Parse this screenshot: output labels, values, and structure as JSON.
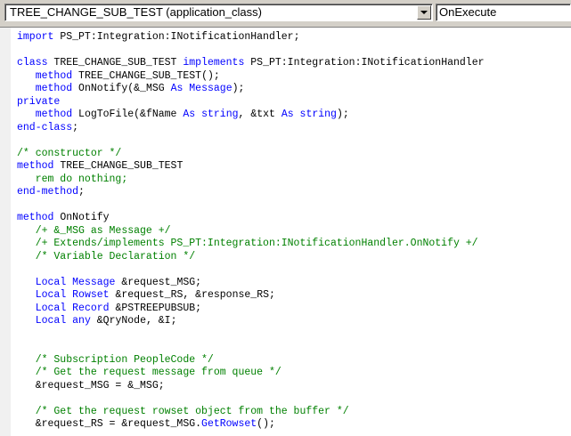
{
  "toolbar": {
    "object_name": "TREE_CHANGE_SUB_TEST  (application_class)",
    "event_name": "OnExecute"
  },
  "colors": {
    "keyword": "#0000ff",
    "comment": "#008000",
    "text": "#000000"
  },
  "code_lines": [
    [
      {
        "t": "import",
        "s": "kw"
      },
      {
        "t": " PS_PT:Integration:INotificationHandler;",
        "s": ""
      }
    ],
    [],
    [
      {
        "t": "class",
        "s": "kw"
      },
      {
        "t": " TREE_CHANGE_SUB_TEST ",
        "s": ""
      },
      {
        "t": "implements",
        "s": "kw"
      },
      {
        "t": " PS_PT:Integration:INotificationHandler",
        "s": ""
      }
    ],
    [
      {
        "t": "   ",
        "s": ""
      },
      {
        "t": "method",
        "s": "kw"
      },
      {
        "t": " TREE_CHANGE_SUB_TEST();",
        "s": ""
      }
    ],
    [
      {
        "t": "   ",
        "s": ""
      },
      {
        "t": "method",
        "s": "kw"
      },
      {
        "t": " OnNotify(&_MSG ",
        "s": ""
      },
      {
        "t": "As",
        "s": "kw"
      },
      {
        "t": " ",
        "s": ""
      },
      {
        "t": "Message",
        "s": "kw"
      },
      {
        "t": ");",
        "s": ""
      }
    ],
    [
      {
        "t": "private",
        "s": "kw"
      }
    ],
    [
      {
        "t": "   ",
        "s": ""
      },
      {
        "t": "method",
        "s": "kw"
      },
      {
        "t": " LogToFile(&fName ",
        "s": ""
      },
      {
        "t": "As",
        "s": "kw"
      },
      {
        "t": " ",
        "s": ""
      },
      {
        "t": "string",
        "s": "kw"
      },
      {
        "t": ", &txt ",
        "s": ""
      },
      {
        "t": "As",
        "s": "kw"
      },
      {
        "t": " ",
        "s": ""
      },
      {
        "t": "string",
        "s": "kw"
      },
      {
        "t": ");",
        "s": ""
      }
    ],
    [
      {
        "t": "end-class",
        "s": "kw"
      },
      {
        "t": ";",
        "s": ""
      }
    ],
    [],
    [
      {
        "t": "/* constructor */",
        "s": "cm"
      }
    ],
    [
      {
        "t": "method",
        "s": "kw"
      },
      {
        "t": " TREE_CHANGE_SUB_TEST",
        "s": ""
      }
    ],
    [
      {
        "t": "   rem do nothing;",
        "s": "cm"
      }
    ],
    [
      {
        "t": "end-method",
        "s": "kw"
      },
      {
        "t": ";",
        "s": ""
      }
    ],
    [],
    [
      {
        "t": "method",
        "s": "kw"
      },
      {
        "t": " OnNotify",
        "s": ""
      }
    ],
    [
      {
        "t": "   /+ &_MSG as Message +/",
        "s": "cm"
      }
    ],
    [
      {
        "t": "   /+ Extends/implements PS_PT:Integration:INotificationHandler.OnNotify +/",
        "s": "cm"
      }
    ],
    [
      {
        "t": "   /* Variable Declaration */",
        "s": "cm"
      }
    ],
    [],
    [
      {
        "t": "   ",
        "s": ""
      },
      {
        "t": "Local",
        "s": "kw"
      },
      {
        "t": " ",
        "s": ""
      },
      {
        "t": "Message",
        "s": "kw"
      },
      {
        "t": " &request_MSG;",
        "s": ""
      }
    ],
    [
      {
        "t": "   ",
        "s": ""
      },
      {
        "t": "Local",
        "s": "kw"
      },
      {
        "t": " ",
        "s": ""
      },
      {
        "t": "Rowset",
        "s": "kw"
      },
      {
        "t": " &request_RS, &response_RS;",
        "s": ""
      }
    ],
    [
      {
        "t": "   ",
        "s": ""
      },
      {
        "t": "Local",
        "s": "kw"
      },
      {
        "t": " ",
        "s": ""
      },
      {
        "t": "Record",
        "s": "kw"
      },
      {
        "t": " &PSTREEPUBSUB;",
        "s": ""
      }
    ],
    [
      {
        "t": "   ",
        "s": ""
      },
      {
        "t": "Local",
        "s": "kw"
      },
      {
        "t": " ",
        "s": ""
      },
      {
        "t": "any",
        "s": "kw"
      },
      {
        "t": " &QryNode, &I;",
        "s": ""
      }
    ],
    [],
    [],
    [
      {
        "t": "   /* Subscription PeopleCode */",
        "s": "cm"
      }
    ],
    [
      {
        "t": "   /* Get the request message from queue */",
        "s": "cm"
      }
    ],
    [
      {
        "t": "   &request_MSG = &_MSG;",
        "s": ""
      }
    ],
    [],
    [
      {
        "t": "   /* Get the request rowset object from the buffer */",
        "s": "cm"
      }
    ],
    [
      {
        "t": "   &request_RS = &request_MSG.",
        "s": ""
      },
      {
        "t": "GetRowset",
        "s": "kw"
      },
      {
        "t": "();",
        "s": ""
      }
    ]
  ]
}
